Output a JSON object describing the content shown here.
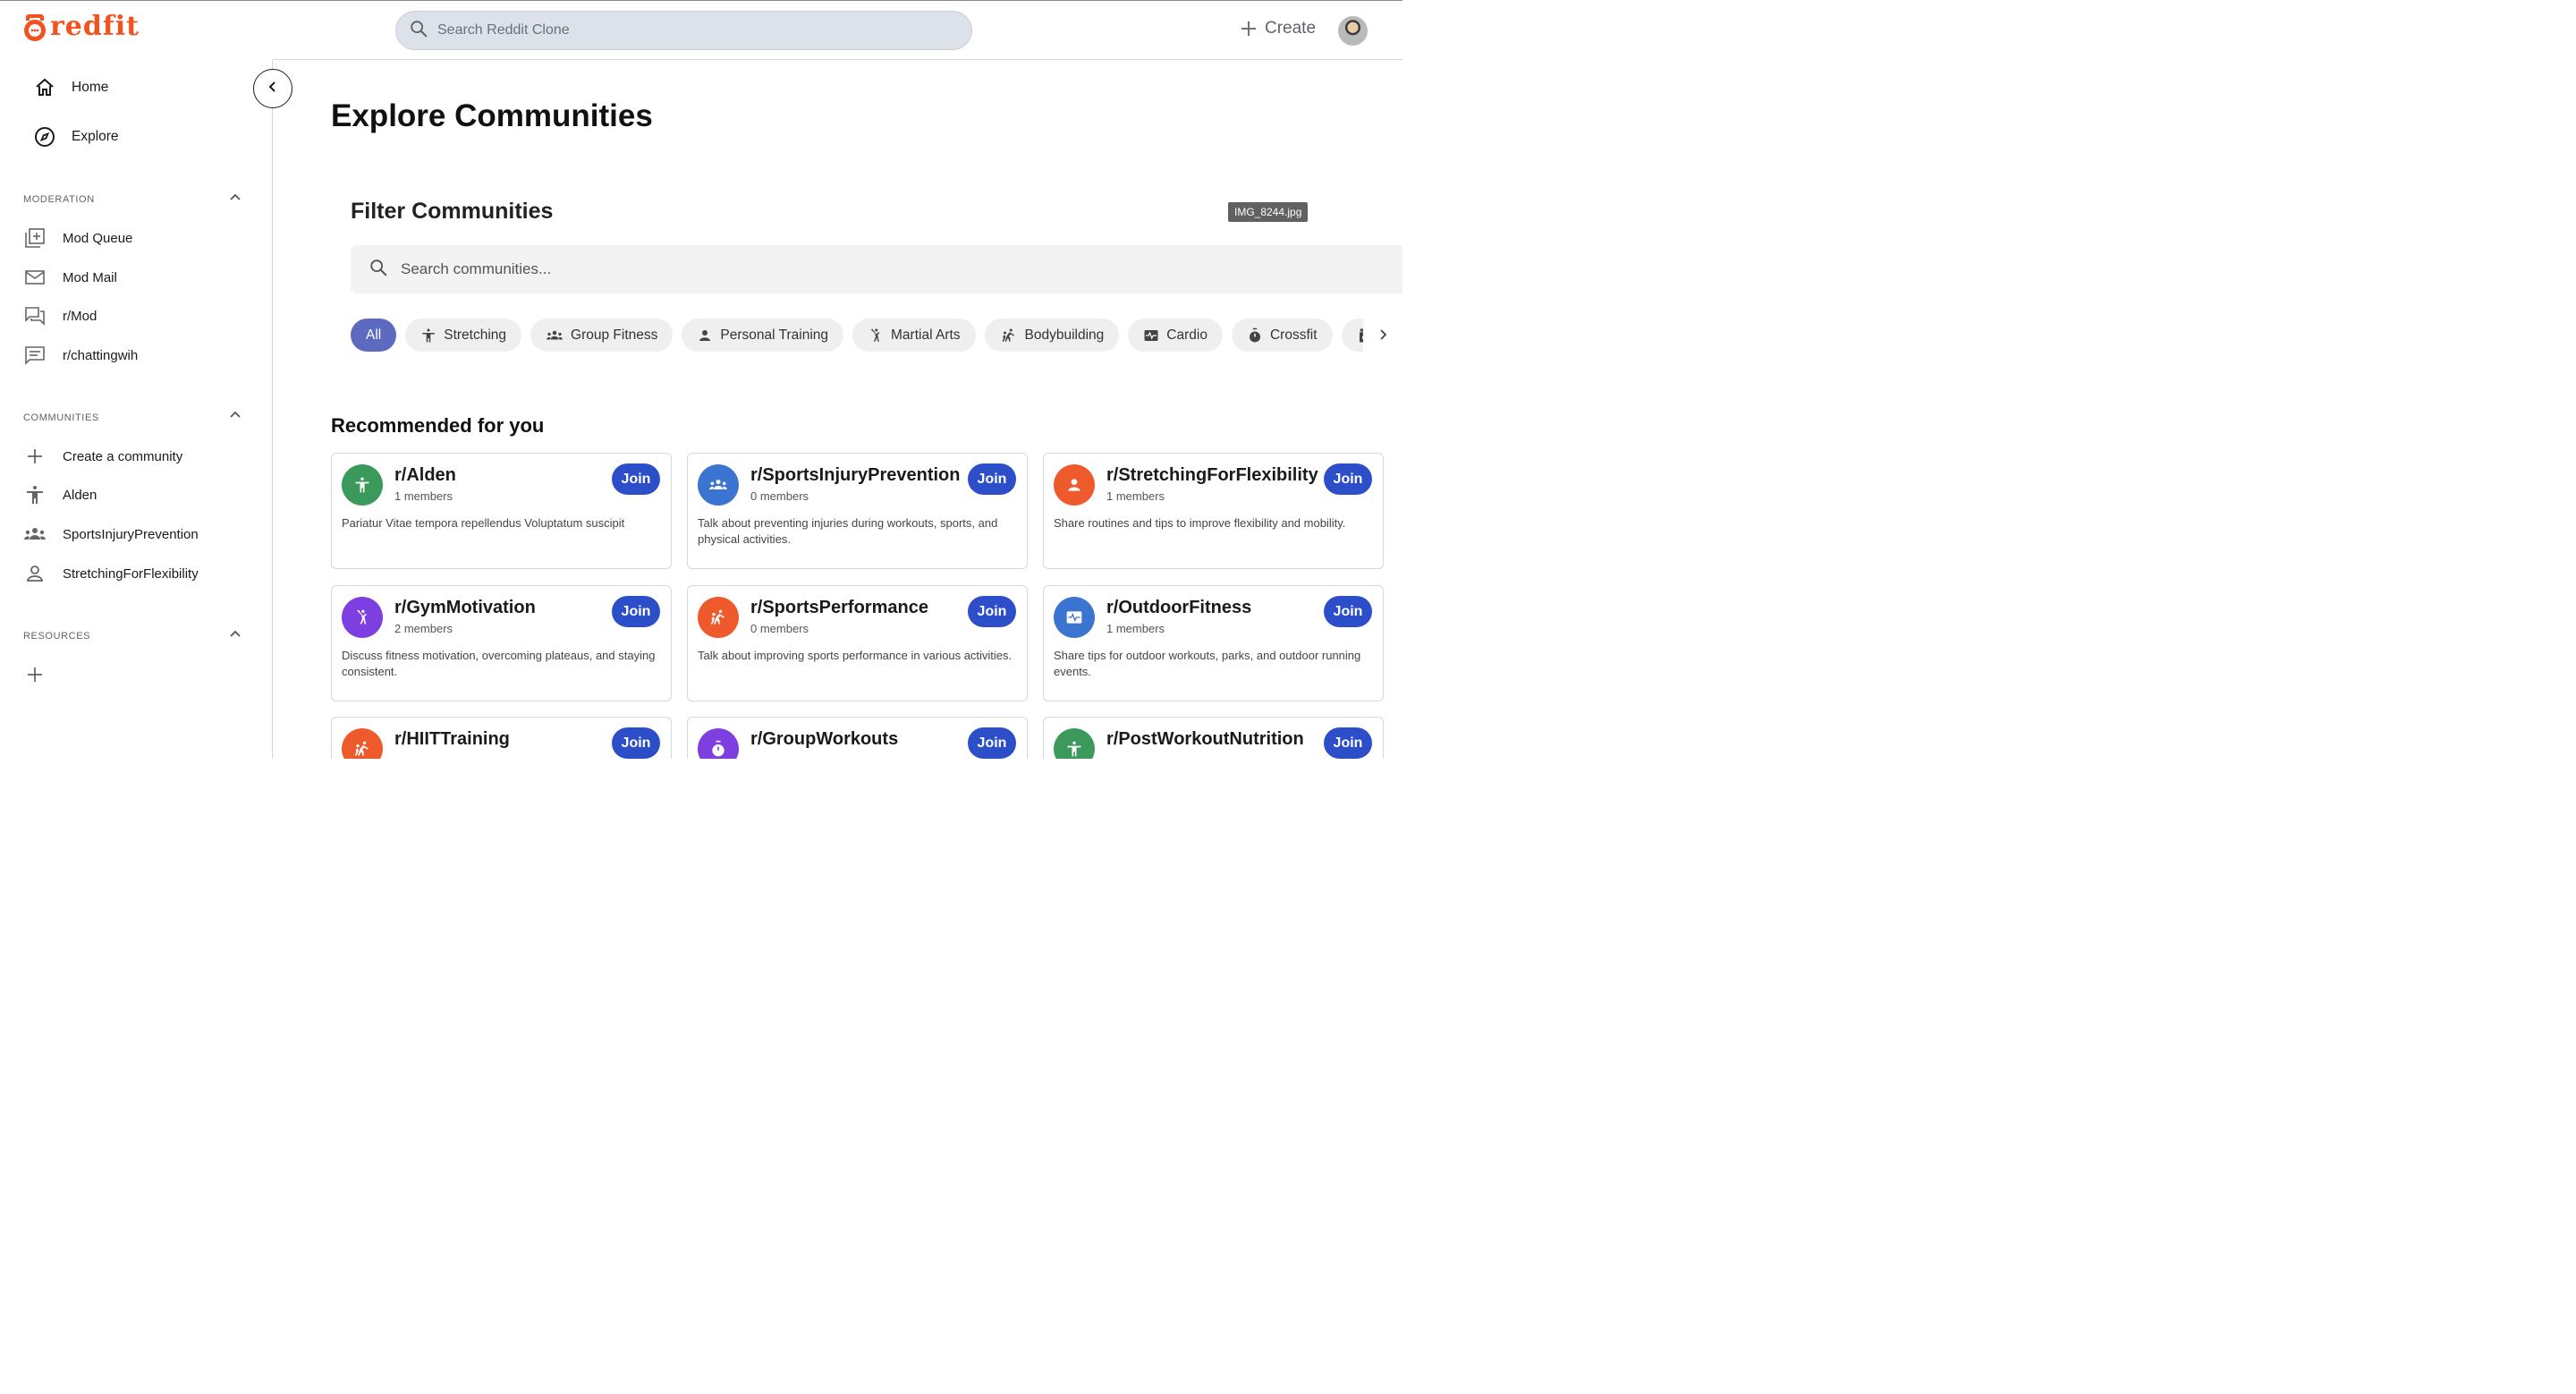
{
  "header": {
    "logo_text": "redfit",
    "search_placeholder": "Search Reddit Clone",
    "create_label": "Create"
  },
  "sidebar": {
    "nav": [
      {
        "label": "Home",
        "icon": "home-icon"
      },
      {
        "label": "Explore",
        "icon": "compass-icon"
      }
    ],
    "moderation": {
      "title": "MODERATION",
      "items": [
        {
          "label": "Mod Queue",
          "icon": "mod-queue-icon"
        },
        {
          "label": "Mod Mail",
          "icon": "mail-icon"
        },
        {
          "label": "r/Mod",
          "icon": "forum-icon"
        },
        {
          "label": "r/chattingwih",
          "icon": "chat-icon"
        }
      ]
    },
    "communities": {
      "title": "COMMUNITIES",
      "items": [
        {
          "label": "Create a community",
          "icon": "plus-icon"
        },
        {
          "label": "Alden",
          "icon": "accessibility-icon"
        },
        {
          "label": "SportsInjuryPrevention",
          "icon": "groups-icon"
        },
        {
          "label": "StretchingForFlexibility",
          "icon": "person-icon"
        }
      ]
    },
    "resources": {
      "title": "RESOURCES"
    }
  },
  "main": {
    "title": "Explore Communities",
    "filter_title": "Filter Communities",
    "tooltip": "IMG_8244.jpg",
    "search_placeholder": "Search communities...",
    "chips": [
      {
        "label": "All",
        "icon": ""
      },
      {
        "label": "Stretching",
        "icon": "accessibility-icon"
      },
      {
        "label": "Group Fitness",
        "icon": "groups-icon"
      },
      {
        "label": "Personal Training",
        "icon": "person-icon"
      },
      {
        "label": "Martial Arts",
        "icon": "martial-arts-icon"
      },
      {
        "label": "Bodybuilding",
        "icon": "sports-handball-icon"
      },
      {
        "label": "Cardio",
        "icon": "monitor-heart-icon"
      },
      {
        "label": "Crossfit",
        "icon": "timer-icon"
      },
      {
        "label": "",
        "icon": "medication-icon"
      }
    ],
    "recommended_title": "Recommended for you",
    "join_label": "Join",
    "cards": [
      {
        "name": "r/Alden",
        "members": "1 members",
        "description": "Pariatur Vitae tempora repellendus Voluptatum suscipit",
        "color": "#3b9a5b",
        "icon": "accessibility-icon"
      },
      {
        "name": "r/SportsInjuryPrevention",
        "members": "0 members",
        "description": "Talk about preventing injuries during workouts, sports, and physical activities.",
        "color": "#3b75d1",
        "icon": "groups-icon"
      },
      {
        "name": "r/StretchingForFlexibility",
        "members": "1 members",
        "description": "Share routines and tips to improve flexibility and mobility.",
        "color": "#ee5a2b",
        "icon": "person-icon"
      },
      {
        "name": "r/GymMotivation",
        "members": "2 members",
        "description": "Discuss fitness motivation, overcoming plateaus, and staying consistent.",
        "color": "#7e3fe0",
        "icon": "martial-arts-icon"
      },
      {
        "name": "r/SportsPerformance",
        "members": "0 members",
        "description": "Talk about improving sports performance in various activities.",
        "color": "#ee5a2b",
        "icon": "sports-handball-icon"
      },
      {
        "name": "r/OutdoorFitness",
        "members": "1 members",
        "description": "Share tips for outdoor workouts, parks, and outdoor running events.",
        "color": "#3b75d1",
        "icon": "monitor-heart-icon"
      },
      {
        "name": "r/HIITTraining",
        "members": "",
        "description": "",
        "color": "#ee5a2b",
        "icon": "sports-handball-icon"
      },
      {
        "name": "r/GroupWorkouts",
        "members": "",
        "description": "",
        "color": "#7e3fe0",
        "icon": "timer-icon"
      },
      {
        "name": "r/PostWorkoutNutrition",
        "members": "",
        "description": "",
        "color": "#3b9a5b",
        "icon": "accessibility-icon"
      }
    ]
  }
}
